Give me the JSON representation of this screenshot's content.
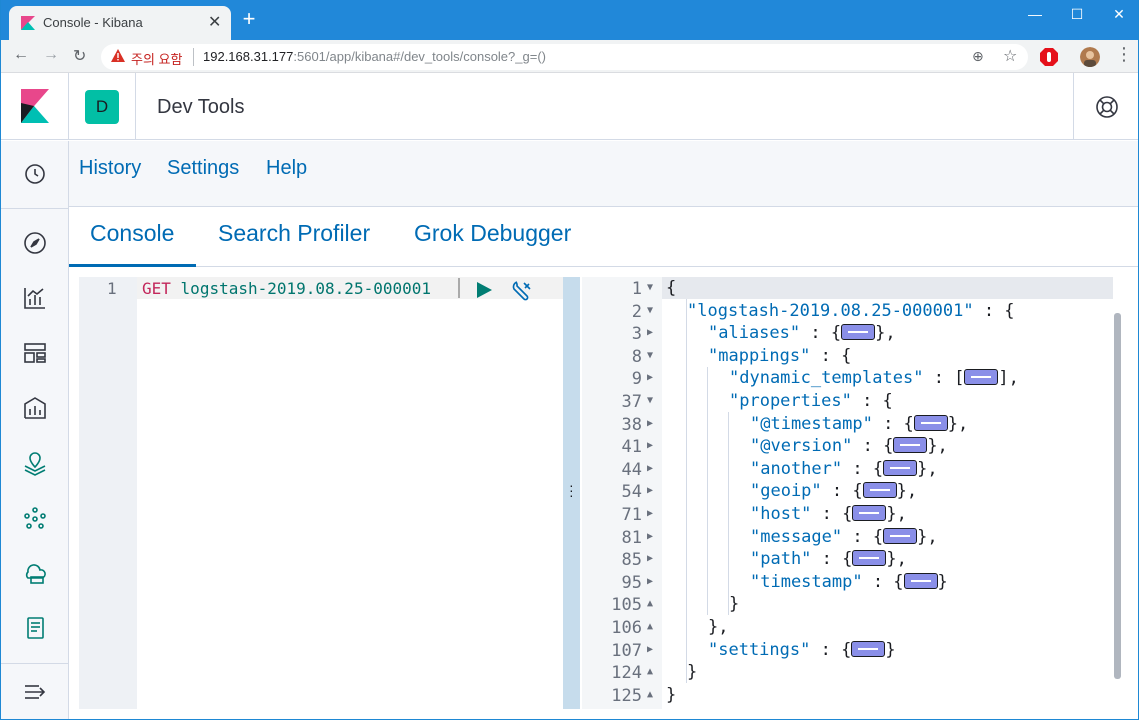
{
  "browser": {
    "tab_title": "Console - Kibana",
    "warning_label": "주의 요함",
    "url_host": "192.168.31.177",
    "url_rest": ":5601/app/kibana#/dev_tools/console?_g=()"
  },
  "header": {
    "space_initial": "D",
    "page_title": "Dev Tools"
  },
  "top_menu": [
    "History",
    "Settings",
    "Help"
  ],
  "tabs": [
    "Console",
    "Search Profiler",
    "Grok Debugger"
  ],
  "request": {
    "line_number": "1",
    "method": "GET",
    "path": "logstash-2019.08.25-000001"
  },
  "response": {
    "lines": [
      {
        "n": "1",
        "fold": "open",
        "indent": 0,
        "text": "{"
      },
      {
        "n": "2",
        "fold": "open",
        "indent": 1,
        "key": "\"logstash-2019.08.25-000001\"",
        "after": " : {"
      },
      {
        "n": "3",
        "fold": "closed",
        "indent": 2,
        "key": "\"aliases\"",
        "after": " : {",
        "collapsed": true,
        "close": "},"
      },
      {
        "n": "8",
        "fold": "open",
        "indent": 2,
        "key": "\"mappings\"",
        "after": " : {"
      },
      {
        "n": "9",
        "fold": "closed",
        "indent": 3,
        "key": "\"dynamic_templates\"",
        "after": " : [",
        "collapsed": true,
        "close": "],"
      },
      {
        "n": "37",
        "fold": "open",
        "indent": 3,
        "key": "\"properties\"",
        "after": " : {"
      },
      {
        "n": "38",
        "fold": "closed",
        "indent": 4,
        "key": "\"@timestamp\"",
        "after": " : {",
        "collapsed": true,
        "close": "},"
      },
      {
        "n": "41",
        "fold": "closed",
        "indent": 4,
        "key": "\"@version\"",
        "after": " : {",
        "collapsed": true,
        "close": "},"
      },
      {
        "n": "44",
        "fold": "closed",
        "indent": 4,
        "key": "\"another\"",
        "after": " : {",
        "collapsed": true,
        "close": "},"
      },
      {
        "n": "54",
        "fold": "closed",
        "indent": 4,
        "key": "\"geoip\"",
        "after": " : {",
        "collapsed": true,
        "close": "},"
      },
      {
        "n": "71",
        "fold": "closed",
        "indent": 4,
        "key": "\"host\"",
        "after": " : {",
        "collapsed": true,
        "close": "},"
      },
      {
        "n": "81",
        "fold": "closed",
        "indent": 4,
        "key": "\"message\"",
        "after": " : {",
        "collapsed": true,
        "close": "},"
      },
      {
        "n": "85",
        "fold": "closed",
        "indent": 4,
        "key": "\"path\"",
        "after": " : {",
        "collapsed": true,
        "close": "},"
      },
      {
        "n": "95",
        "fold": "closed",
        "indent": 4,
        "key": "\"timestamp\"",
        "after": " : {",
        "collapsed": true,
        "close": "}"
      },
      {
        "n": "105",
        "fold": "end",
        "indent": 3,
        "text": "}"
      },
      {
        "n": "106",
        "fold": "end",
        "indent": 2,
        "text": "},"
      },
      {
        "n": "107",
        "fold": "closed",
        "indent": 2,
        "key": "\"settings\"",
        "after": " : {",
        "collapsed": true,
        "close": "}"
      },
      {
        "n": "124",
        "fold": "end",
        "indent": 1,
        "text": "}"
      },
      {
        "n": "125",
        "fold": "end",
        "indent": 0,
        "text": "}"
      }
    ]
  },
  "colors": {
    "browser_frame": "#2188d9",
    "link": "#006bb4",
    "space_badge": "#02bfa5",
    "method": "#c3275b",
    "request_url": "#00756e",
    "fold_badge": "#8a8fe8"
  }
}
